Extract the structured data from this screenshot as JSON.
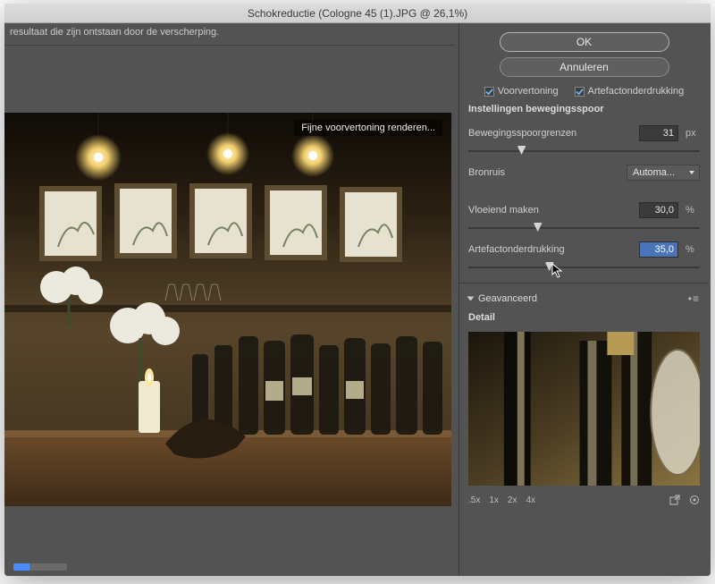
{
  "window": {
    "title": "Schokreductie (Cologne 45 (1).JPG @ 26,1%)"
  },
  "hint": "resultaat die zijn ontstaan door de verscherping.",
  "preview": {
    "badge": "Fijne voorvertoning renderen..."
  },
  "buttons": {
    "ok": "OK",
    "cancel": "Annuleren"
  },
  "checks": {
    "preview": "Voorvertoning",
    "artifact": "Artefactonderdrukking"
  },
  "section_title": "Instellingen bewegingsspoor",
  "blur_bounds": {
    "label": "Bewegingsspoorgrenzen",
    "value": "31",
    "unit": "px",
    "knob_left": "23%"
  },
  "source_noise": {
    "label": "Bronruis",
    "value": "Automa..."
  },
  "smoothing": {
    "label": "Vloeiend maken",
    "value": "30,0",
    "unit": "%",
    "knob_left": "30%"
  },
  "artifact": {
    "label": "Artefactonderdrukking",
    "value": "35,0",
    "unit": "%",
    "knob_left": "35%"
  },
  "advanced": {
    "label": "Geavanceerd",
    "menu_glyph": "•≡"
  },
  "detail": {
    "label": "Detail"
  },
  "zoom": {
    "z05": ".5x",
    "z1": "1x",
    "z2": "2x",
    "z4": "4x"
  }
}
